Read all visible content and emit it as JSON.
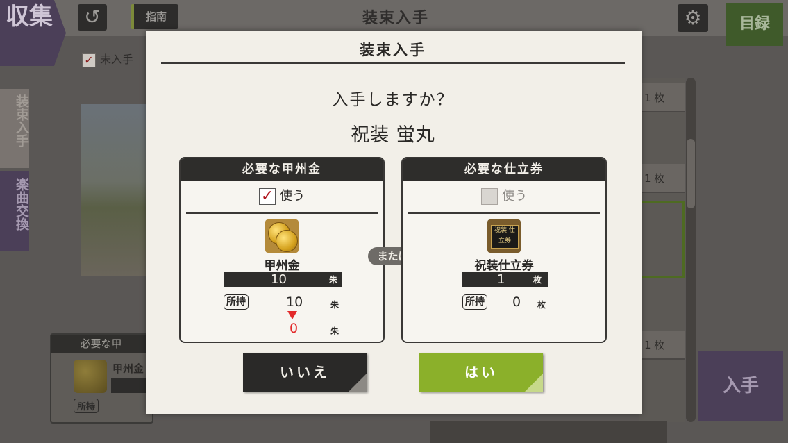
{
  "background": {
    "corner_label": "収集",
    "guide_label": "指南",
    "screen_title": "装束入手",
    "catalog_label": "目録",
    "unobtained_filter": "未入手",
    "side_tabs": [
      "装束入手",
      "楽曲交換"
    ],
    "bottom_panel": {
      "header": "必要な甲",
      "item": "甲州金",
      "own_tag": "所持"
    },
    "right_list_unit": "1 枚",
    "obtain_button": "入手"
  },
  "modal": {
    "title": "装束入手",
    "question": "入手しますか？",
    "item_name": "祝装 蛍丸",
    "left_card": {
      "header": "必要な甲州金",
      "use_label": "使う",
      "use_checked": true,
      "item": "甲州金",
      "required": "10",
      "required_unit": "朱",
      "own_tag": "所持",
      "owned": "10",
      "owned_unit": "朱",
      "after": "0",
      "after_unit": "朱"
    },
    "or_label": "または",
    "right_card": {
      "header": "必要な仕立券",
      "use_label": "使う",
      "use_checked": false,
      "item": "祝装仕立券",
      "icon_text": "祝装 仕立券",
      "required": "1",
      "required_unit": "枚",
      "own_tag": "所持",
      "owned": "0",
      "owned_unit": "枚"
    },
    "no_button": "いいえ",
    "yes_button": "はい"
  },
  "colors": {
    "accent_green": "#8bb02a",
    "alert_red": "#e32a2a",
    "check_red": "#b0131b"
  }
}
